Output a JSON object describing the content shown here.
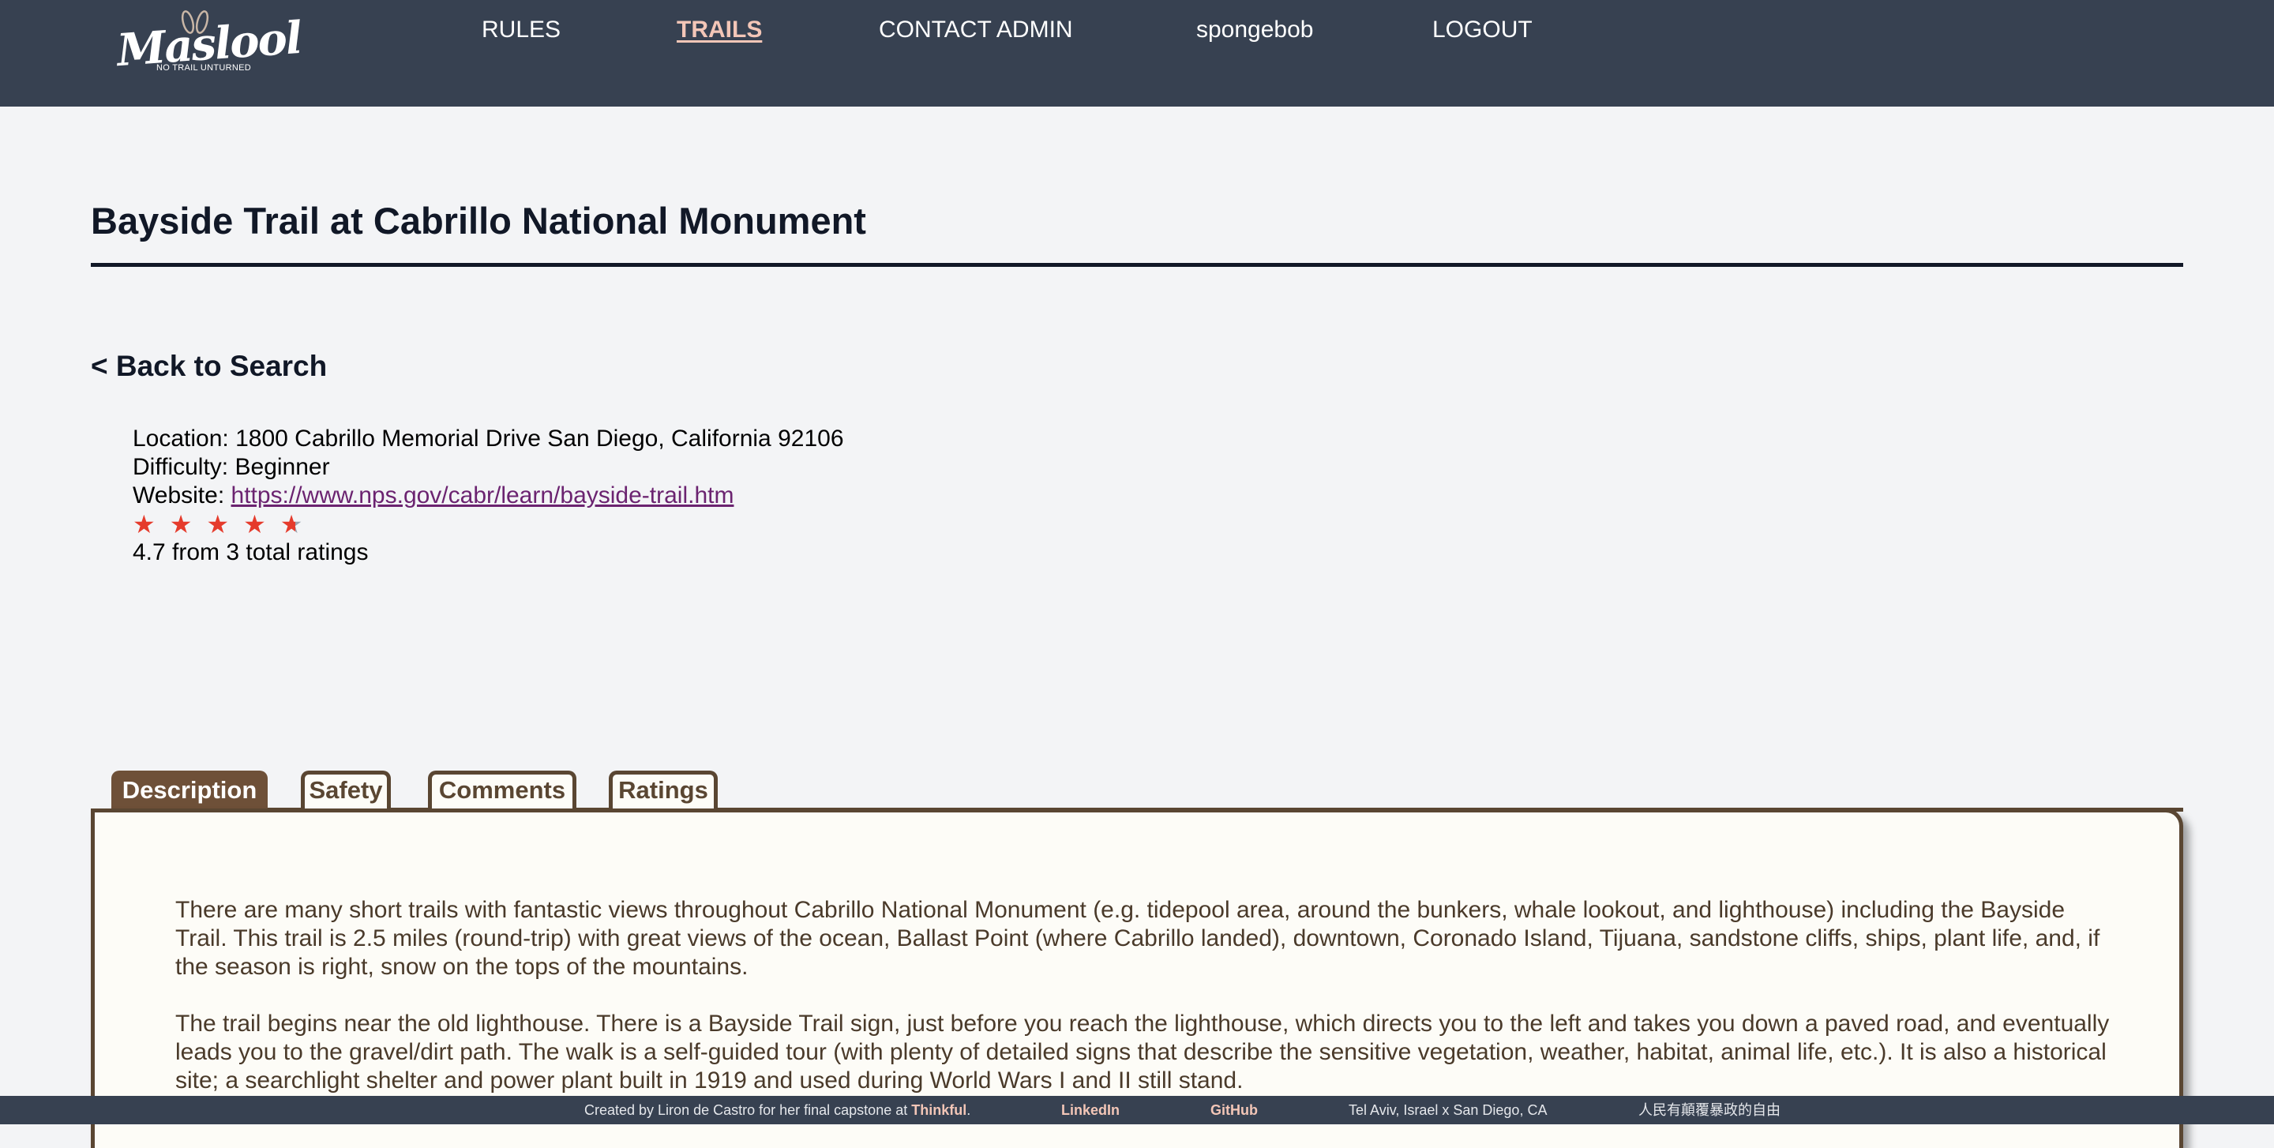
{
  "header": {
    "logo_text": "Maslool",
    "logo_tagline": "NO TRAIL UNTURNED",
    "nav": [
      {
        "label": "RULES"
      },
      {
        "label": "TRAILS"
      },
      {
        "label": "CONTACT ADMIN"
      },
      {
        "label": "spongebob"
      },
      {
        "label": "LOGOUT"
      }
    ]
  },
  "trail": {
    "title": "Bayside Trail at Cabrillo National Monument",
    "back_label": "< Back to Search",
    "location_label": "Location:",
    "location": "1800 Cabrillo Memorial Drive San Diego, California 92106",
    "difficulty_label": "Difficulty:",
    "difficulty": "Beginner",
    "website_label": "Website:",
    "website": "https://www.nps.gov/cabr/learn/bayside-trail.htm",
    "rating_value": 4.7,
    "rating_max": 5,
    "rating_text": "4.7 from 3 total ratings"
  },
  "tabs": [
    {
      "label": "Description",
      "active": true
    },
    {
      "label": "Safety",
      "active": false
    },
    {
      "label": "Comments",
      "active": false
    },
    {
      "label": "Ratings",
      "active": false
    }
  ],
  "description": {
    "paragraphs": [
      "There are many short trails with fantastic views throughout Cabrillo National Monument (e.g. tidepool area, around the bunkers, whale lookout, and lighthouse) including the Bayside Trail. This trail is 2.5 miles (round-trip) with great views of the ocean, Ballast Point (where Cabrillo landed), downtown, Coronado Island, Tijuana, sandstone cliffs, ships, plant life, and, if the season is right, snow on the tops of the mountains.",
      "The trail begins near the old lighthouse. There is a Bayside Trail sign, just before you reach the lighthouse, which directs you to the left and takes you down a paved road, and eventually leads you to the gravel/dirt path. The walk is a self-guided tour (with plenty of detailed signs that describe the sensitive vegetation, weather, habitat, animal life, etc.). It is also a historical site; a searchlight shelter and power plant built in 1919 and used during World Wars I and II still stand."
    ]
  },
  "footer": {
    "credit_prefix": "Created by Liron de Castro for her final capstone at",
    "credit_school": "Thinkful",
    "credit_suffix": ".",
    "linkedin": "LinkedIn",
    "github": "GitHub",
    "location": "Tel Aviv, Israel x San Diego, CA",
    "slogan": "人民有顛覆暴政的自由"
  },
  "colors": {
    "navbar": "#374151",
    "accent": "#f3c6b7",
    "tab_border": "#5a4632",
    "star": "#e53b2c",
    "link_visited": "#6b2370"
  }
}
